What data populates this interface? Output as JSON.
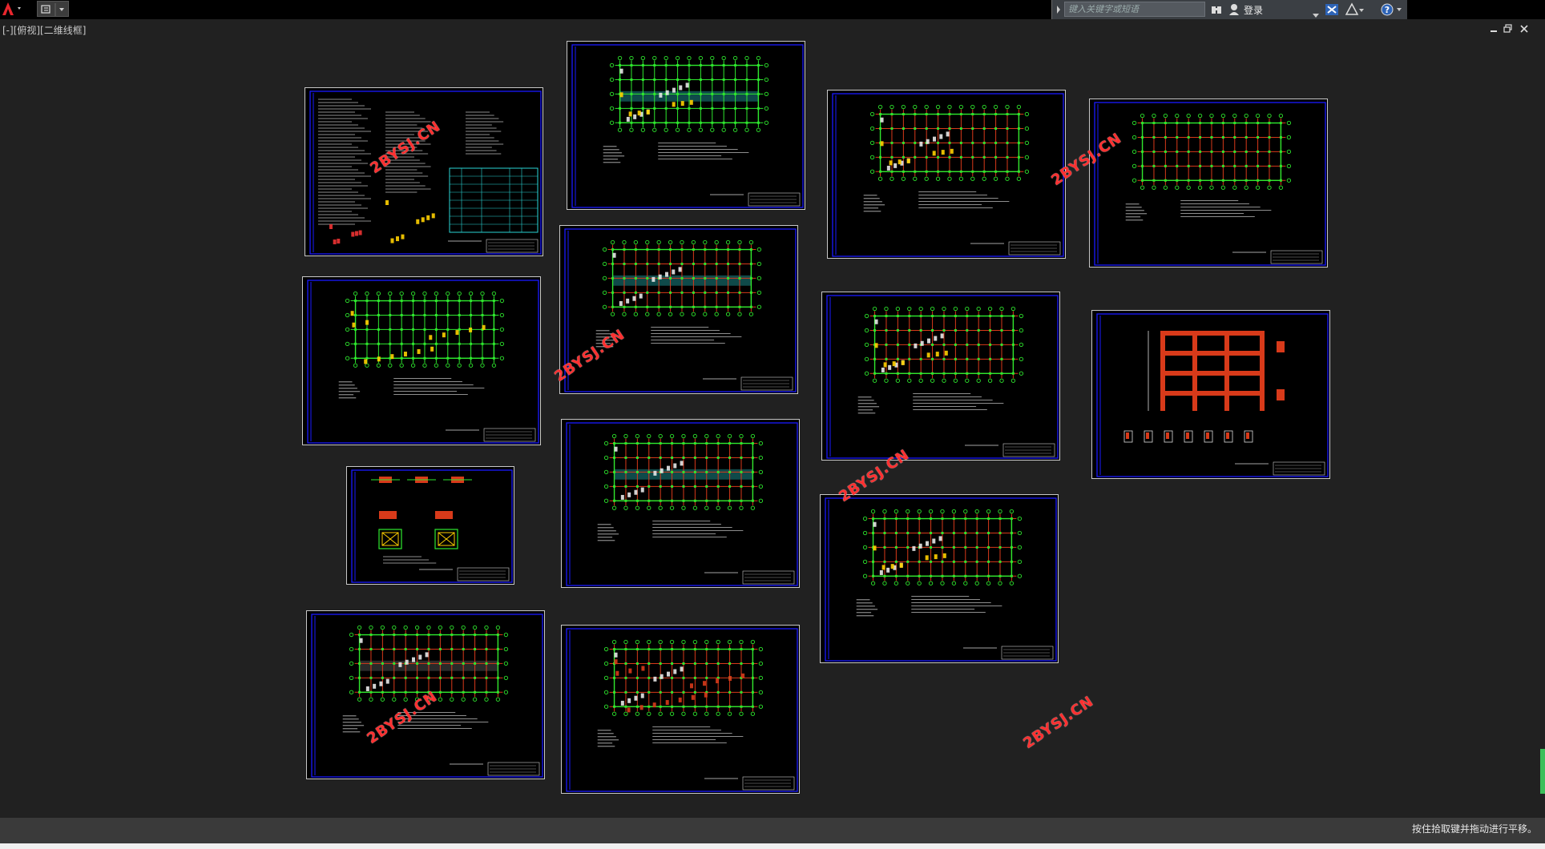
{
  "toolbar": {
    "search_placeholder": "键入关键字或短语",
    "login_label": "登录",
    "help_label": "?"
  },
  "viewport": {
    "label": "[-][俯视][二维线框]"
  },
  "watermarks": [
    "2BYSJ.CN",
    "2BYSJ.CN",
    "2BYSJ.CN",
    "2BYSJ.CN",
    "2BYSJ.CN",
    "2BYSJ.CN"
  ],
  "status": {
    "message": "按住拾取键并拖动进行平移。"
  },
  "colors": {
    "background": "#212121",
    "sheet_border": "#1a1aff",
    "grid_green": "#2ee82e",
    "beam_red": "#d83a1a",
    "cyan": "#2ad4d4",
    "watermark": "#ff3030"
  }
}
